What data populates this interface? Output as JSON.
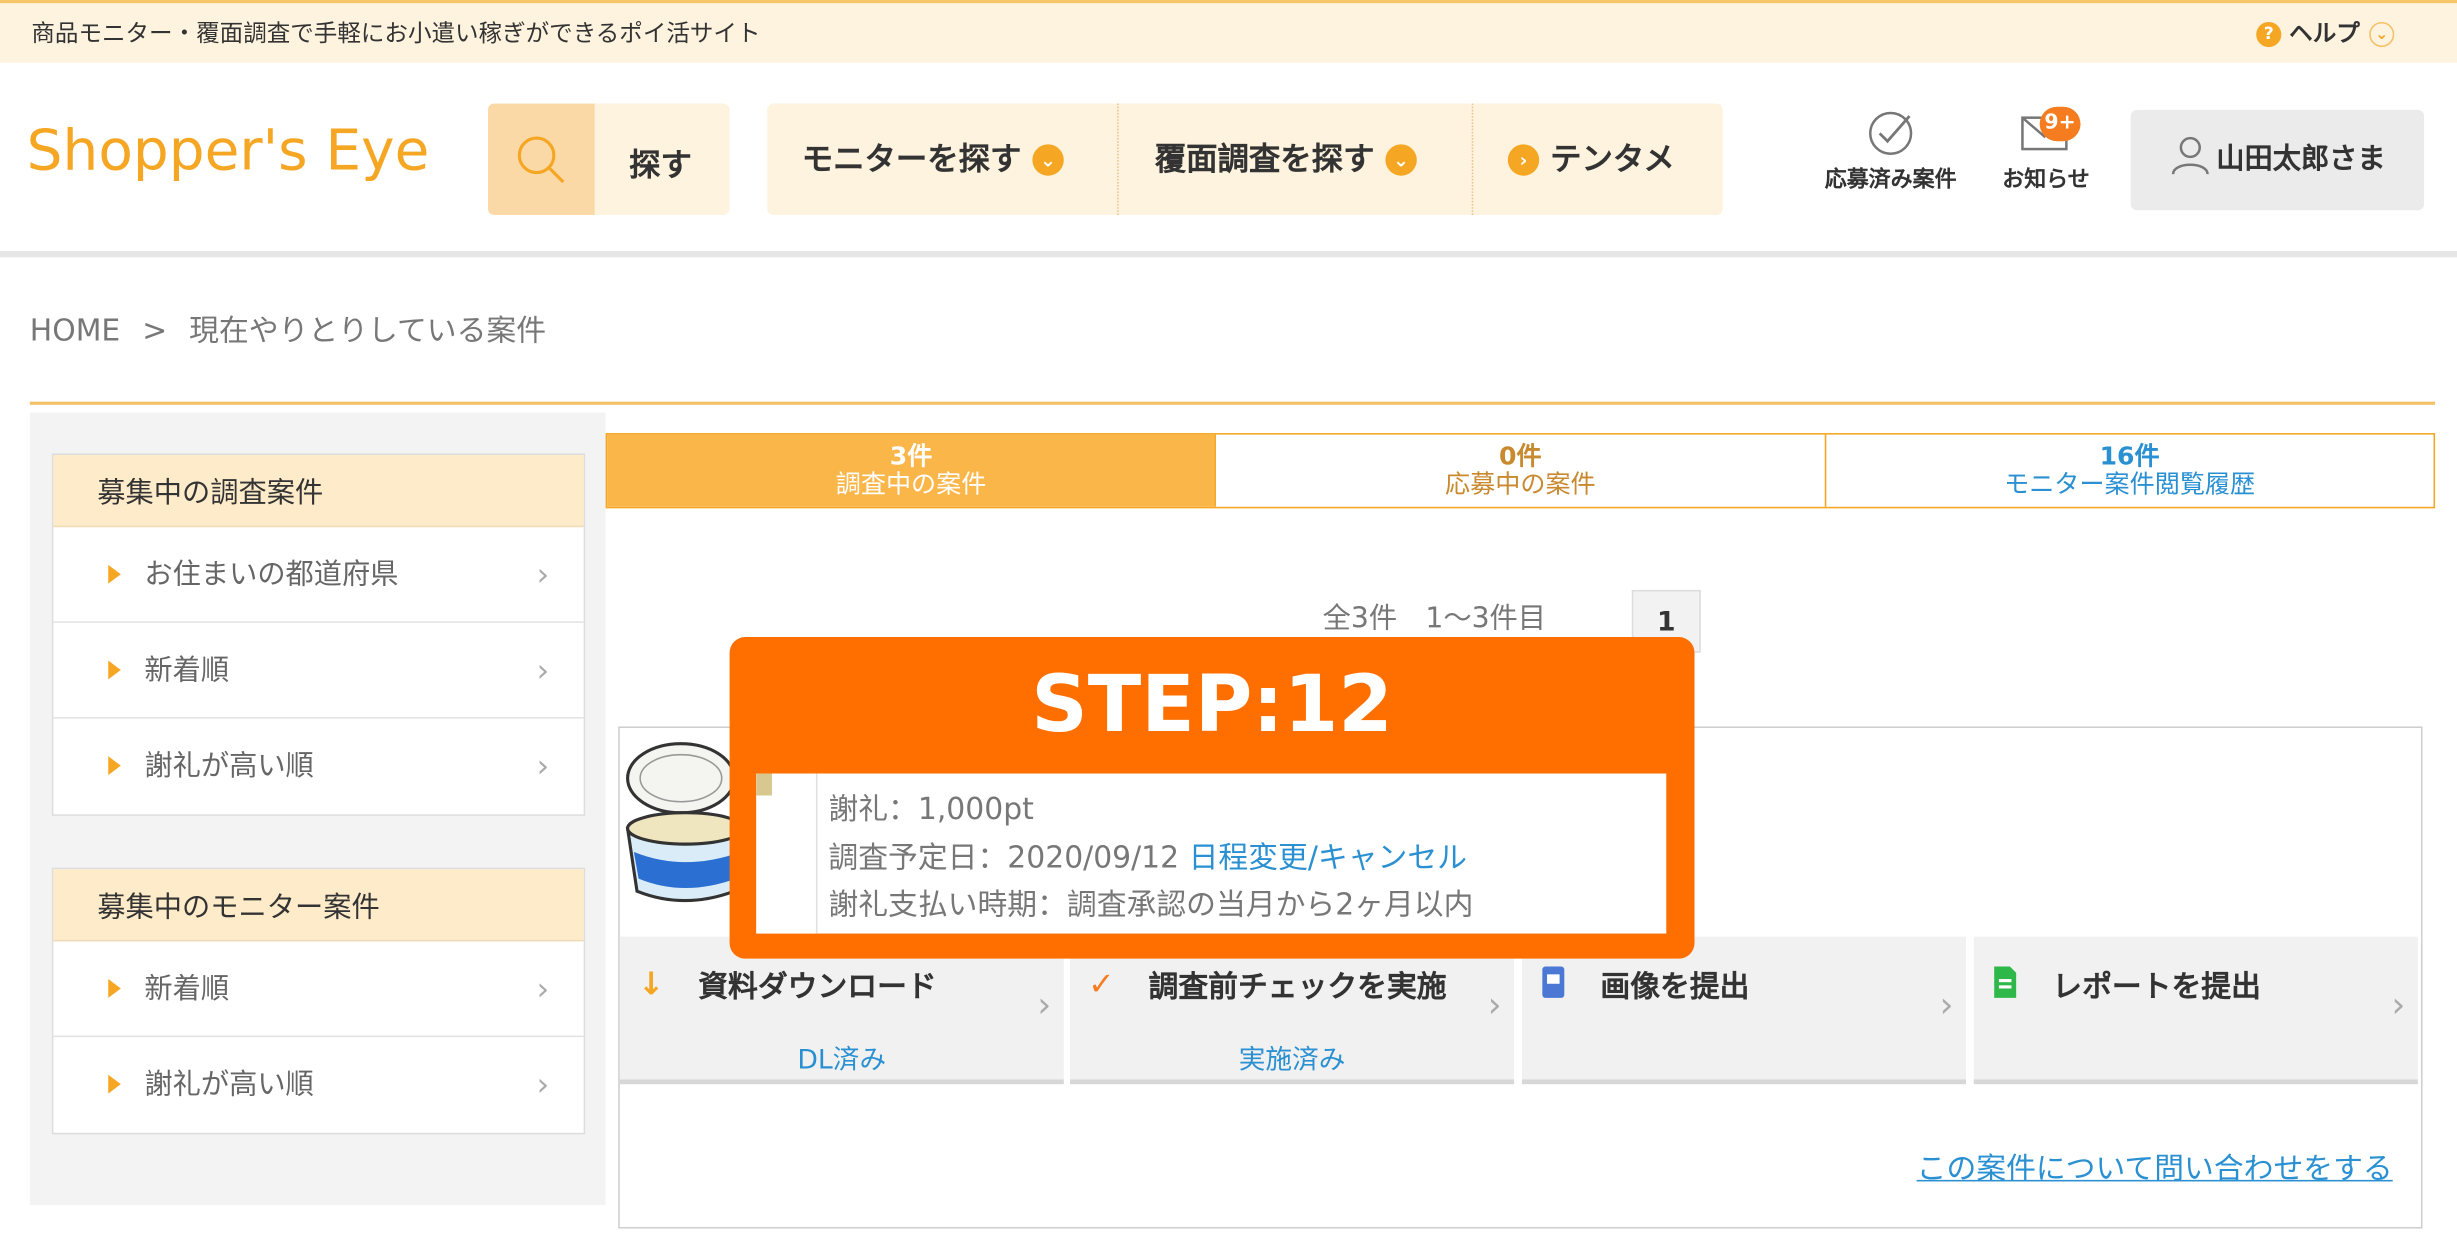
{
  "topbar": {
    "tagline": "商品モニター・覆面調査で手軽にお小遣い稼ぎができるポイ活サイト",
    "help_icon": "?",
    "help_label": "ヘルプ",
    "help_chevron": "⌄"
  },
  "header": {
    "logo": "Shopper's Eye",
    "search_label": "探す",
    "nav": {
      "monitor": "モニターを探す",
      "mystery": "覆面調査を探す",
      "tentame": "テンタメ"
    },
    "applied_label": "応募済み案件",
    "notice_label": "お知らせ",
    "notice_badge": "9+",
    "user_label": "山田太郎さま"
  },
  "breadcrumb": {
    "home": "HOME",
    "sep": ">",
    "current": "現在やりとりしている案件"
  },
  "sidebar": {
    "survey": {
      "title": "募集中の調査案件",
      "items": [
        {
          "label": "お住まいの都道府県"
        },
        {
          "label": "新着順"
        },
        {
          "label": "謝礼が高い順"
        }
      ]
    },
    "monitor": {
      "title": "募集中のモニター案件",
      "items": [
        {
          "label": "新着順"
        },
        {
          "label": "謝礼が高い順"
        }
      ]
    },
    "chevron": "›"
  },
  "tabs": [
    {
      "count": "3件",
      "label": "調査中の案件"
    },
    {
      "count": "0件",
      "label": "応募中の案件"
    },
    {
      "count": "16件",
      "label": "モニター案件閲覧履歴"
    }
  ],
  "pager": {
    "summary": "全3件　1〜3件目",
    "page": "1"
  },
  "card": {
    "reward": "謝礼：1,000pt",
    "schedule_prefix": "調査予定日：2020/09/12 ",
    "schedule_link": "日程変更/キャンセル",
    "payment": "謝礼支払い時期：調査承認の当月から2ヶ月以内",
    "actions": [
      {
        "label": "資料ダウンロード",
        "status": "DL済み",
        "icon": "↓"
      },
      {
        "label": "調査前チェックを実施",
        "status": "実施済み",
        "icon": "✓"
      },
      {
        "label": "画像を提出",
        "status": "",
        "icon": "▮"
      },
      {
        "label": "レポートを提出",
        "status": "",
        "icon": "▮"
      }
    ],
    "contact_link": "この案件について問い合わせをする"
  },
  "step": {
    "title": "STEP:12"
  },
  "colors": {
    "accent": "#f5a623",
    "step_bg": "#ff6f00",
    "link": "#2a90d2",
    "tab_active": "#fbb64a"
  }
}
